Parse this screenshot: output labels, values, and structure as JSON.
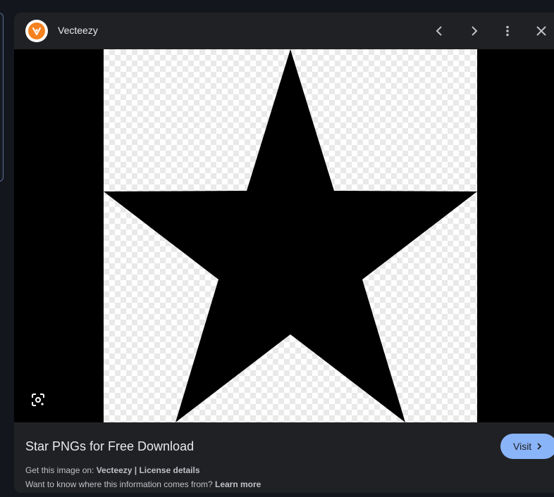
{
  "header": {
    "source_name": "Vecteezy",
    "logo_icon": "vecteezy-logo",
    "buttons": [
      "chevron-left-icon",
      "chevron-right-icon",
      "more-vert-icon",
      "close-icon"
    ]
  },
  "image": {
    "subject_icon": "star-icon",
    "lens_icon": "google-lens-icon"
  },
  "details": {
    "title": "Star PNGs for Free Download",
    "visit_label": "Visit",
    "get_prefix": "Get this image on: ",
    "source_link": "Vecteezy",
    "separator": " | ",
    "license_link": "License details",
    "info_question": "Want to know where this information comes from? ",
    "learn_more": "Learn more"
  },
  "colors": {
    "accent": "#8ab4f8",
    "panel": "#202124",
    "brand_orange": "#f5821f"
  }
}
